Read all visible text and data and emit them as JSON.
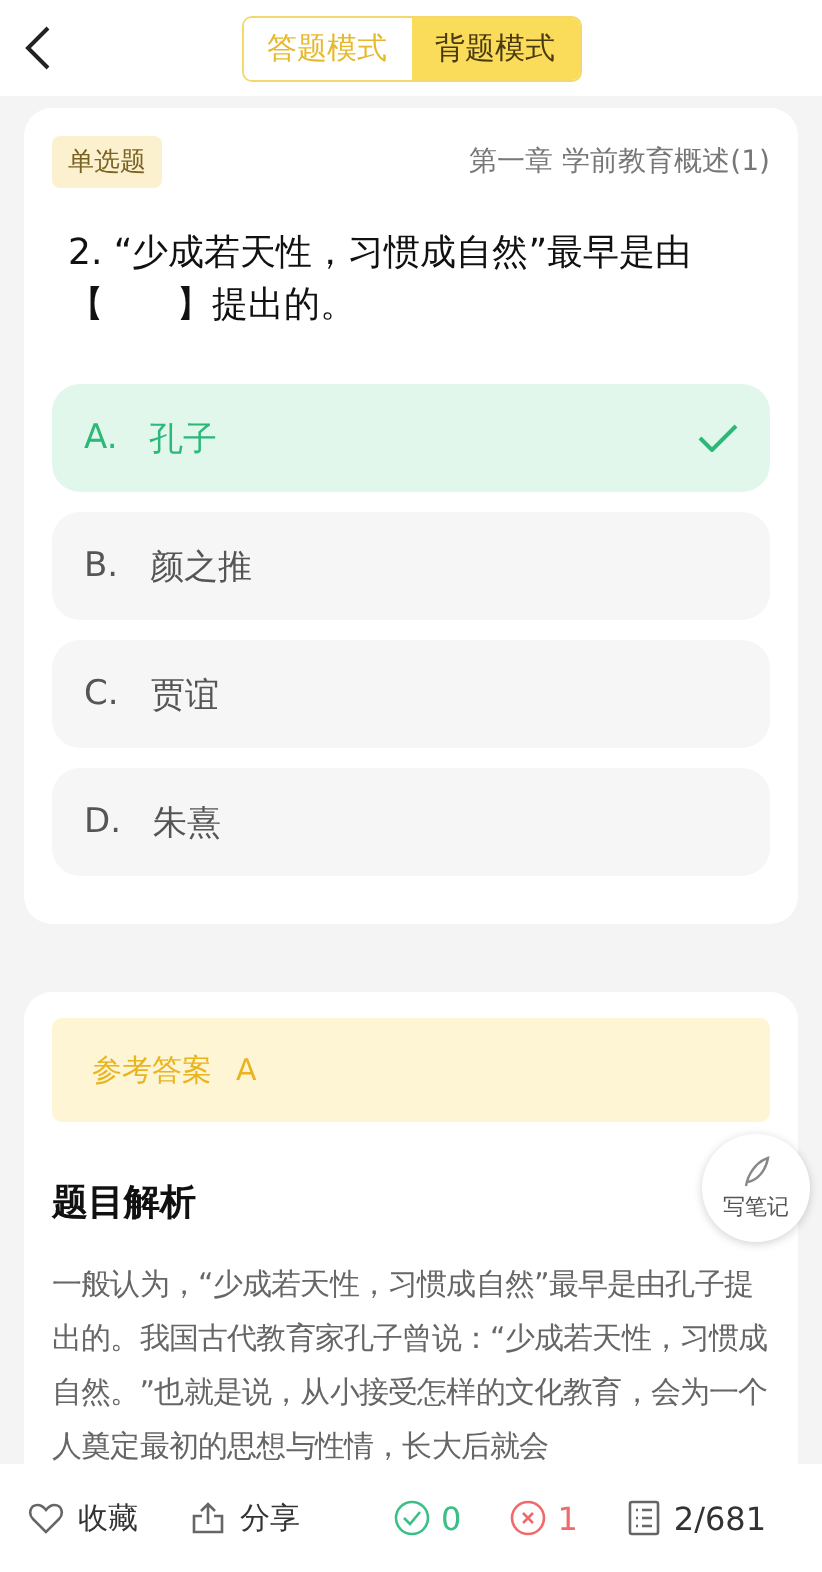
{
  "mode_tabs": [
    {
      "label": "答题模式",
      "selected": false
    },
    {
      "label": "背题模式",
      "selected": true
    }
  ],
  "question": {
    "type_badge": "单选题",
    "chapter": "第一章 学前教育概述(1)",
    "text": "2. “少成若天性，习惯成自然”最早是由【　　】提出的。",
    "options": [
      {
        "letter": "A.",
        "text": "孔子",
        "selected": true
      },
      {
        "letter": "B.",
        "text": "颜之推",
        "selected": false
      },
      {
        "letter": "C.",
        "text": "贾谊",
        "selected": false
      },
      {
        "letter": "D.",
        "text": "朱熹",
        "selected": false
      }
    ]
  },
  "answer": {
    "label": "参考答案",
    "value": "A"
  },
  "analysis": {
    "title": "题目解析",
    "text": "一般认为，“少成若天性，习惯成自然”最早是由孔子提出的。我国古代教育家孔子曾说：“少成若天性，习惯成自然。”也就是说，从小接受怎样的文化教育，会为一个人奠定最初的思想与性情，长大后就会"
  },
  "note_button": {
    "label": "写笔记"
  },
  "bottom_bar": {
    "favorite": "收藏",
    "share": "分享",
    "correct_count": "0",
    "wrong_count": "1",
    "progress": "2/681"
  }
}
